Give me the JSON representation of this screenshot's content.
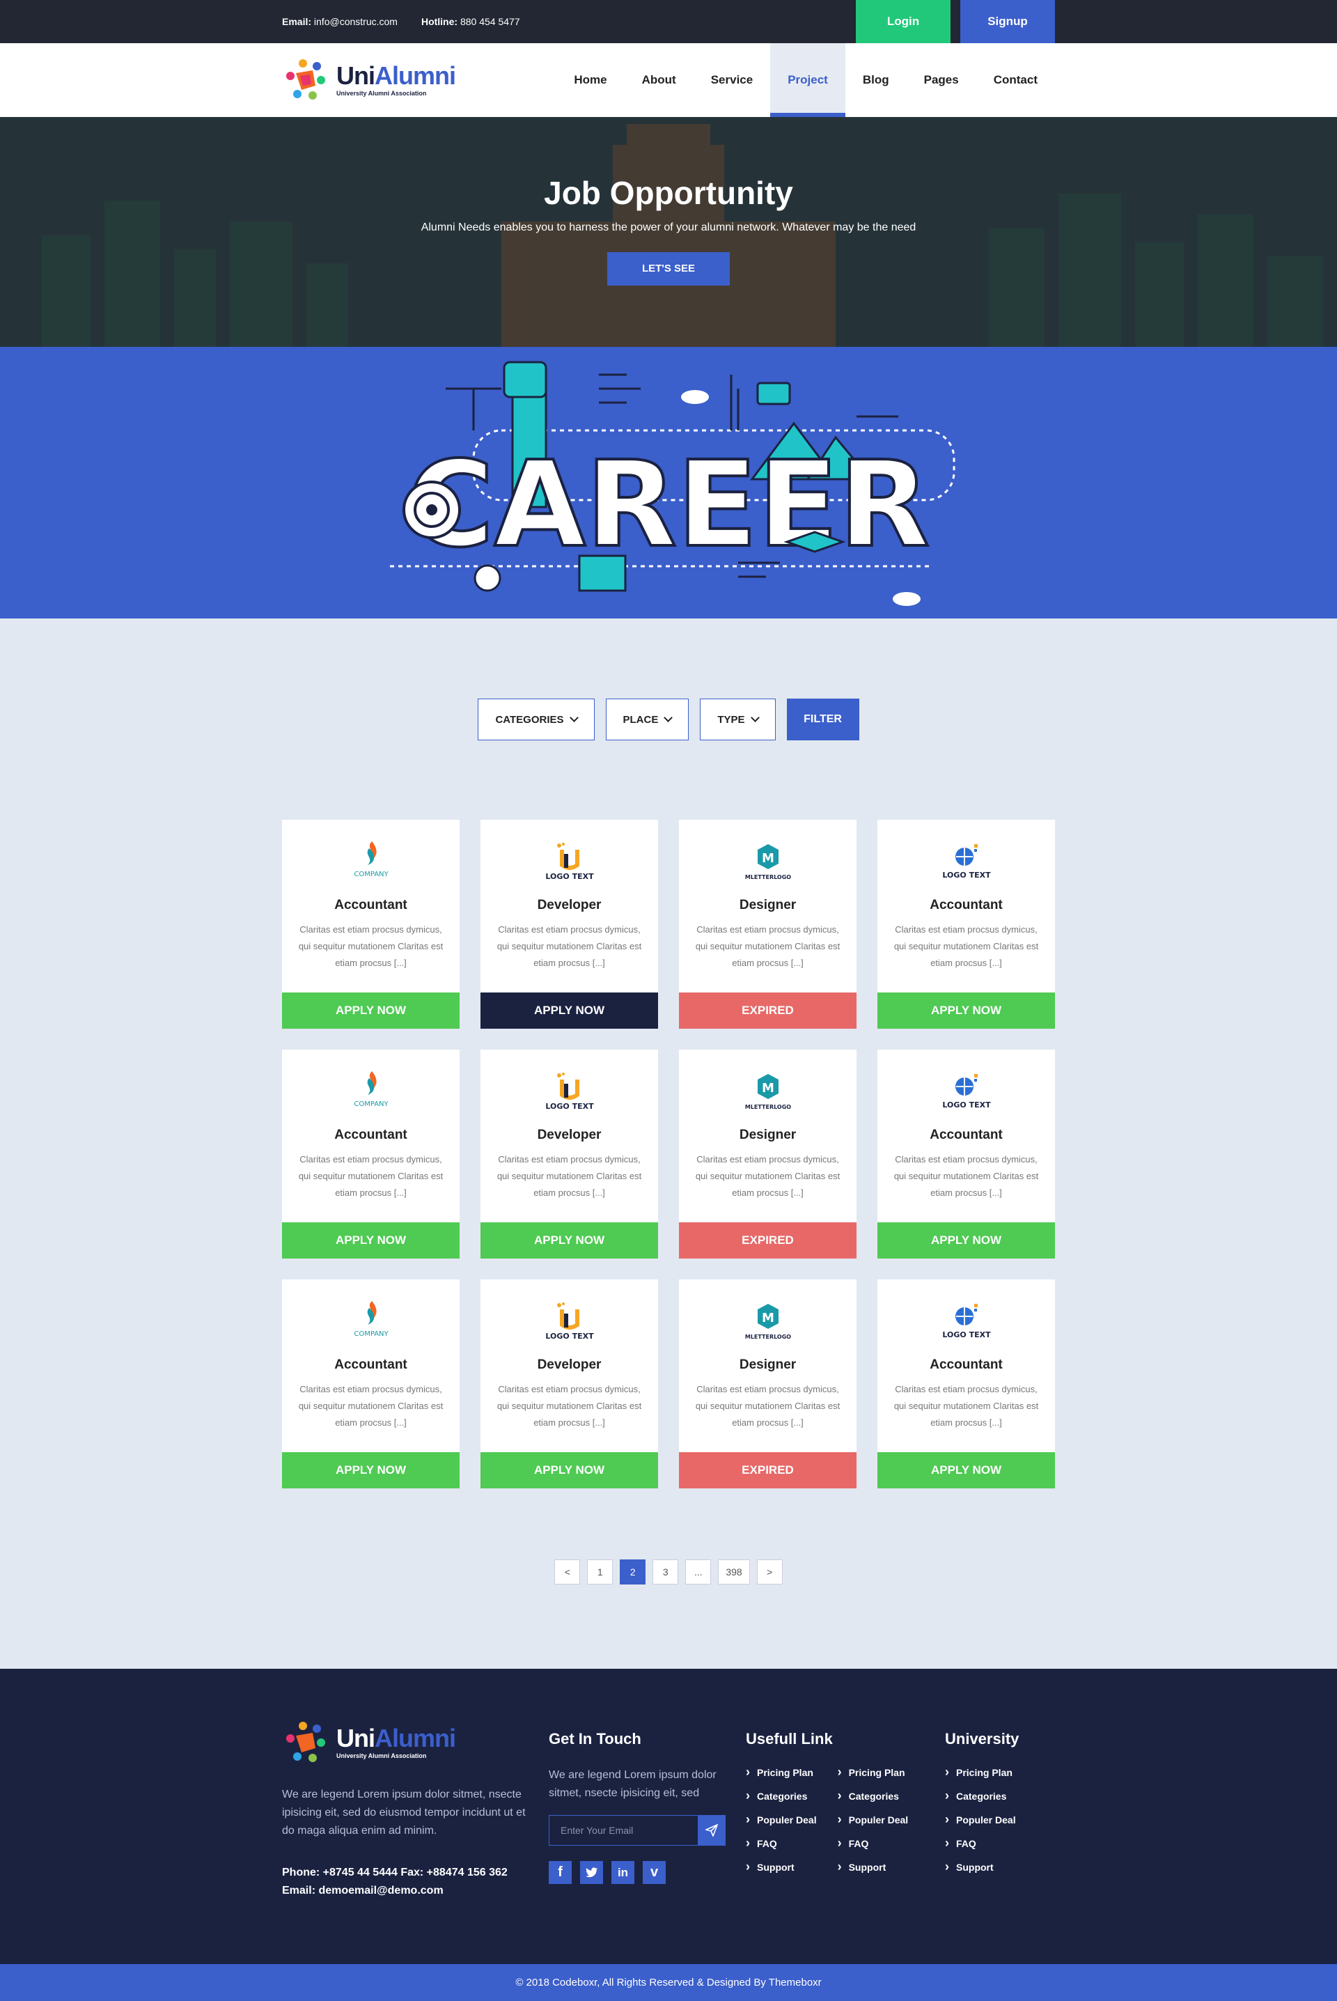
{
  "topbar": {
    "email_label": "Email:",
    "email": "info@construc.com",
    "hotline_label": "Hotline:",
    "hotline": "880 454 5477",
    "login": "Login",
    "signup": "Signup"
  },
  "brand": {
    "uni": "Uni",
    "alumni": "Alumni",
    "tagline": "University Alumni Association"
  },
  "nav": {
    "items": [
      {
        "label": "Home",
        "active": false
      },
      {
        "label": "About",
        "active": false
      },
      {
        "label": "Service",
        "active": false
      },
      {
        "label": "Project",
        "active": true
      },
      {
        "label": "Blog",
        "active": false
      },
      {
        "label": "Pages",
        "active": false
      },
      {
        "label": "Contact",
        "active": false
      }
    ]
  },
  "hero": {
    "title": "Job Opportunity",
    "subtitle": "Alumni Needs enables you to harness the power of your alumni network. Whatever may be the need",
    "button": "LET'S SEE"
  },
  "career_banner": {
    "word": "CAREER"
  },
  "filters": {
    "categories": "CATEGORIES",
    "place": "PLACE",
    "type": "TYPE",
    "button": "FILTER"
  },
  "jobs": [
    {
      "title": "Accountant",
      "logo": "company-logo",
      "desc": "Claritas est etiam procsus dymicus, qui sequitur mutationem Claritas est etiam procsus [...]",
      "button": "APPLY NOW",
      "status": "apply"
    },
    {
      "title": "Developer",
      "logo": "logo-text-orange",
      "desc": "Claritas est etiam procsus dymicus, qui sequitur mutationem Claritas est etiam procsus [...]",
      "button": "APPLY NOW",
      "status": "dark"
    },
    {
      "title": "Designer",
      "logo": "mletterlogo",
      "desc": "Claritas est etiam procsus dymicus, qui sequitur mutationem Claritas est etiam procsus [...]",
      "button": "EXPIRED",
      "status": "expired"
    },
    {
      "title": "Accountant",
      "logo": "logo-text-globe",
      "desc": "Claritas est etiam procsus dymicus, qui sequitur mutationem Claritas est etiam procsus [...]",
      "button": "APPLY NOW",
      "status": "apply"
    },
    {
      "title": "Accountant",
      "logo": "company-logo",
      "desc": "Claritas est etiam procsus dymicus, qui sequitur mutationem Claritas est etiam procsus [...]",
      "button": "APPLY NOW",
      "status": "apply"
    },
    {
      "title": "Developer",
      "logo": "logo-text-orange",
      "desc": "Claritas est etiam procsus dymicus, qui sequitur mutationem Claritas est etiam procsus [...]",
      "button": "APPLY NOW",
      "status": "apply"
    },
    {
      "title": "Designer",
      "logo": "mletterlogo",
      "desc": "Claritas est etiam procsus dymicus, qui sequitur mutationem Claritas est etiam procsus [...]",
      "button": "EXPIRED",
      "status": "expired"
    },
    {
      "title": "Accountant",
      "logo": "logo-text-globe",
      "desc": "Claritas est etiam procsus dymicus, qui sequitur mutationem Claritas est etiam procsus [...]",
      "button": "APPLY NOW",
      "status": "apply"
    },
    {
      "title": "Accountant",
      "logo": "company-logo",
      "desc": "Claritas est etiam procsus dymicus, qui sequitur mutationem Claritas est etiam procsus [...]",
      "button": "APPLY NOW",
      "status": "apply"
    },
    {
      "title": "Developer",
      "logo": "logo-text-orange",
      "desc": "Claritas est etiam procsus dymicus, qui sequitur mutationem Claritas est etiam procsus [...]",
      "button": "APPLY NOW",
      "status": "apply"
    },
    {
      "title": "Designer",
      "logo": "mletterlogo",
      "desc": "Claritas est etiam procsus dymicus, qui sequitur mutationem Claritas est etiam procsus [...]",
      "button": "EXPIRED",
      "status": "expired"
    },
    {
      "title": "Accountant",
      "logo": "logo-text-globe",
      "desc": "Claritas est etiam procsus dymicus, qui sequitur mutationem Claritas est etiam procsus [...]",
      "button": "APPLY NOW",
      "status": "apply"
    }
  ],
  "logo_texts": {
    "company": "COMPANY",
    "logotext": "LOGO TEXT",
    "mletter": "MLETTERLOGO"
  },
  "pagination": {
    "prev": "<",
    "pages": [
      "1",
      "2",
      "3",
      "...",
      "398"
    ],
    "current": "2",
    "next": ">"
  },
  "footer": {
    "about": "We are legend Lorem ipsum dolor sitmet, nsecte ipisicing eit, sed do eiusmod tempor incidunt ut et do maga aliqua enim ad minim.",
    "phone": "Phone: +8745 44 5444   Fax: +88474 156 362",
    "email": "Email: demoemail@demo.com",
    "touch_title": "Get In Touch",
    "touch_text": "We are legend Lorem ipsum dolor sitmet, nsecte ipisicing eit, sed",
    "email_placeholder": "Enter Your Email",
    "useful_title": "Usefull Link",
    "useful_links_a": [
      "Pricing Plan",
      "Categories",
      "Populer Deal",
      "FAQ",
      "Support"
    ],
    "useful_links_b": [
      "Pricing Plan",
      "Categories",
      "Populer Deal",
      "FAQ",
      "Support"
    ],
    "university_title": "University",
    "university_links": [
      "Pricing Plan",
      "Categories",
      "Populer Deal",
      "FAQ",
      "Support"
    ],
    "socials": [
      "facebook-icon",
      "twitter-icon",
      "linkedin-icon",
      "vimeo-icon"
    ]
  },
  "copyright": "© 2018 Codeboxr, All Rights Reserved & Designed By Themeboxr",
  "colors": {
    "primary": "#3b5fcb",
    "green": "#4fca53",
    "red": "#e86868",
    "dark": "#1b2240",
    "login": "#21c87a"
  }
}
